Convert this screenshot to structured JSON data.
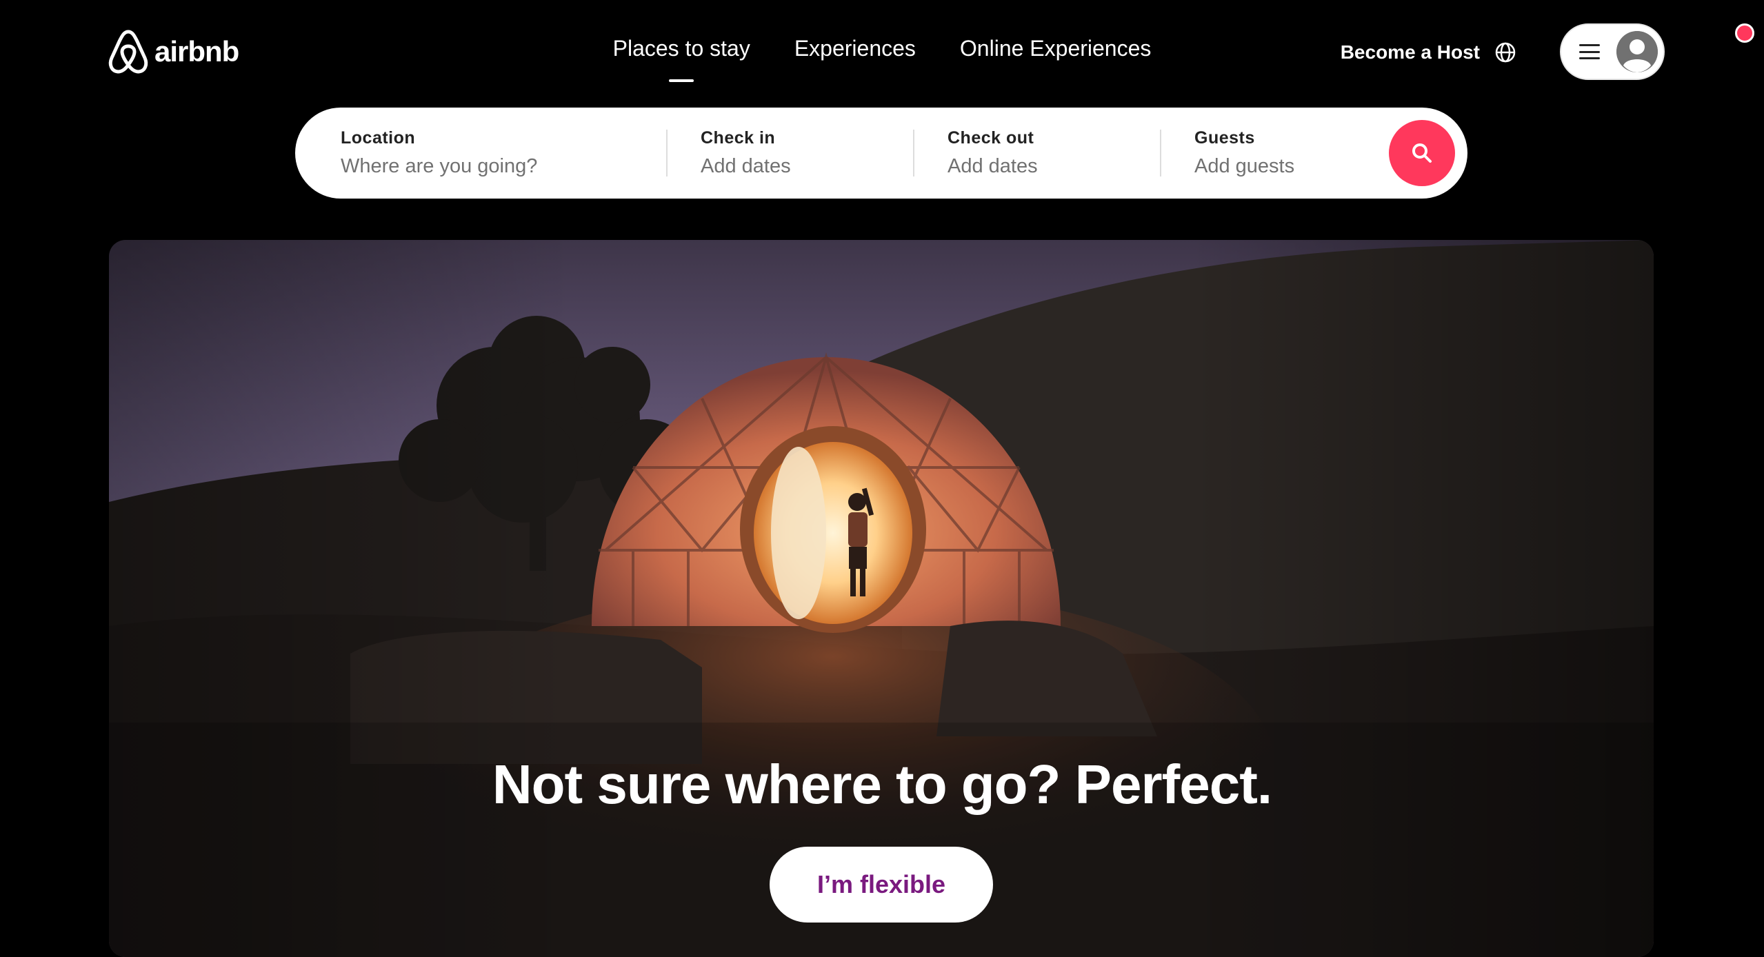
{
  "header": {
    "logo_text": "airbnb",
    "nav": [
      {
        "label": "Places to stay",
        "active": true
      },
      {
        "label": "Experiences",
        "active": false
      },
      {
        "label": "Online Experiences",
        "active": false
      }
    ],
    "become_host": "Become a Host",
    "icons": {
      "logo": "airbnb-logo-icon",
      "language": "globe-icon",
      "menu": "hamburger-menu-icon",
      "user": "user-avatar-icon"
    },
    "notification_color": "#ff385c"
  },
  "search": {
    "location": {
      "label": "Location",
      "placeholder": "Where are you going?"
    },
    "check_in": {
      "label": "Check in",
      "placeholder": "Add dates"
    },
    "check_out": {
      "label": "Check out",
      "placeholder": "Add dates"
    },
    "guests": {
      "label": "Guests",
      "placeholder": "Add guests"
    },
    "button_icon": "search-icon",
    "button_color": "#ff385c"
  },
  "hero": {
    "headline": "Not sure where to go? Perfect.",
    "cta_label": "I’m flexible",
    "cta_color": "#7a1a7f"
  }
}
